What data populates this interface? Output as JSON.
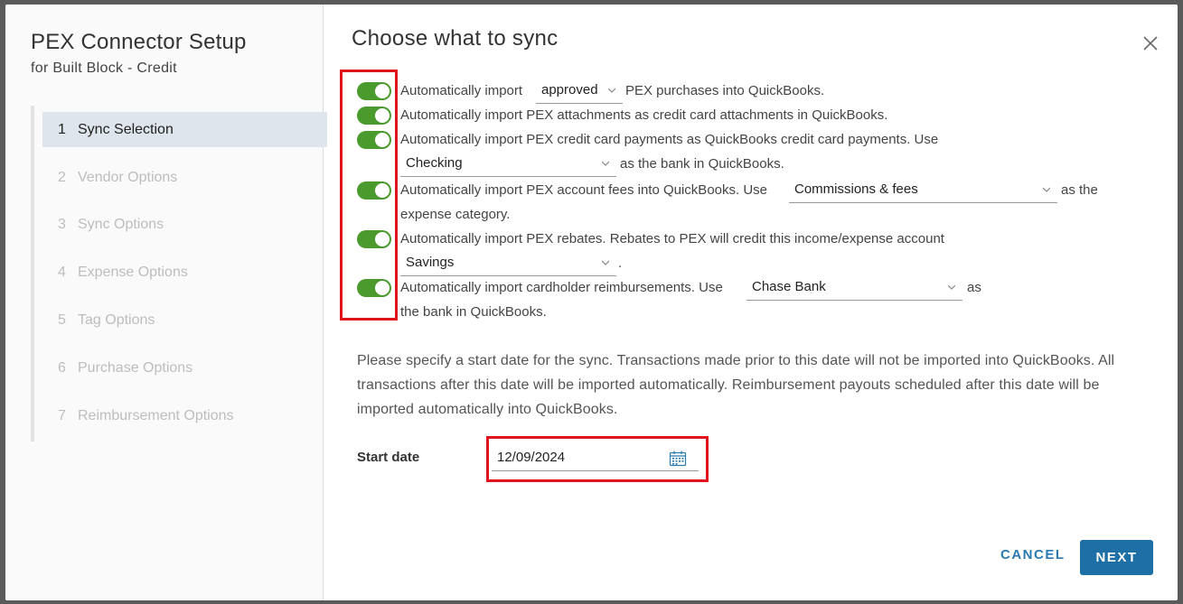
{
  "sidebar": {
    "title": "PEX Connector Setup",
    "subtitle": "for Built Block - Credit",
    "steps": [
      {
        "num": "1",
        "label": "Sync Selection"
      },
      {
        "num": "2",
        "label": "Vendor Options"
      },
      {
        "num": "3",
        "label": "Sync Options"
      },
      {
        "num": "4",
        "label": "Expense Options"
      },
      {
        "num": "5",
        "label": "Tag Options"
      },
      {
        "num": "6",
        "label": "Purchase Options"
      },
      {
        "num": "7",
        "label": "Reimbursement Options"
      }
    ]
  },
  "main": {
    "title": "Choose what to sync",
    "row1": {
      "before": "Automatically import",
      "select": "approved",
      "after": "PEX purchases into QuickBooks."
    },
    "row2": {
      "text": "Automatically import PEX attachments as credit card attachments in QuickBooks."
    },
    "row3": {
      "text": "Automatically import PEX credit card payments as QuickBooks credit card payments. Use",
      "select": "Checking",
      "after": "as the bank in QuickBooks."
    },
    "row4": {
      "text": "Automatically import PEX account fees into QuickBooks. Use",
      "select": "Commissions & fees",
      "after": "as the",
      "line2": "expense category."
    },
    "row5": {
      "text": "Automatically import PEX rebates. Rebates to PEX will credit this income/expense account",
      "select": "Savings",
      "after": "."
    },
    "row6": {
      "text": "Automatically import cardholder reimbursements. Use",
      "select": "Chase Bank",
      "after": "as",
      "line2": "the bank in QuickBooks."
    },
    "description": "Please specify a start date for the sync. Transactions made prior to this date will not be imported into QuickBooks. All transactions after this date will be imported automatically. Reimbursement payouts scheduled after this date will be imported automatically into QuickBooks.",
    "start_date_label": "Start date",
    "start_date_value": "12/09/2024",
    "cancel_label": "CANCEL",
    "next_label": "NEXT"
  },
  "colors": {
    "toggle_on": "#4a9a2d",
    "highlight": "#e0141e",
    "primary": "#1e6fa6",
    "active_step_bg": "#dee5ec"
  }
}
